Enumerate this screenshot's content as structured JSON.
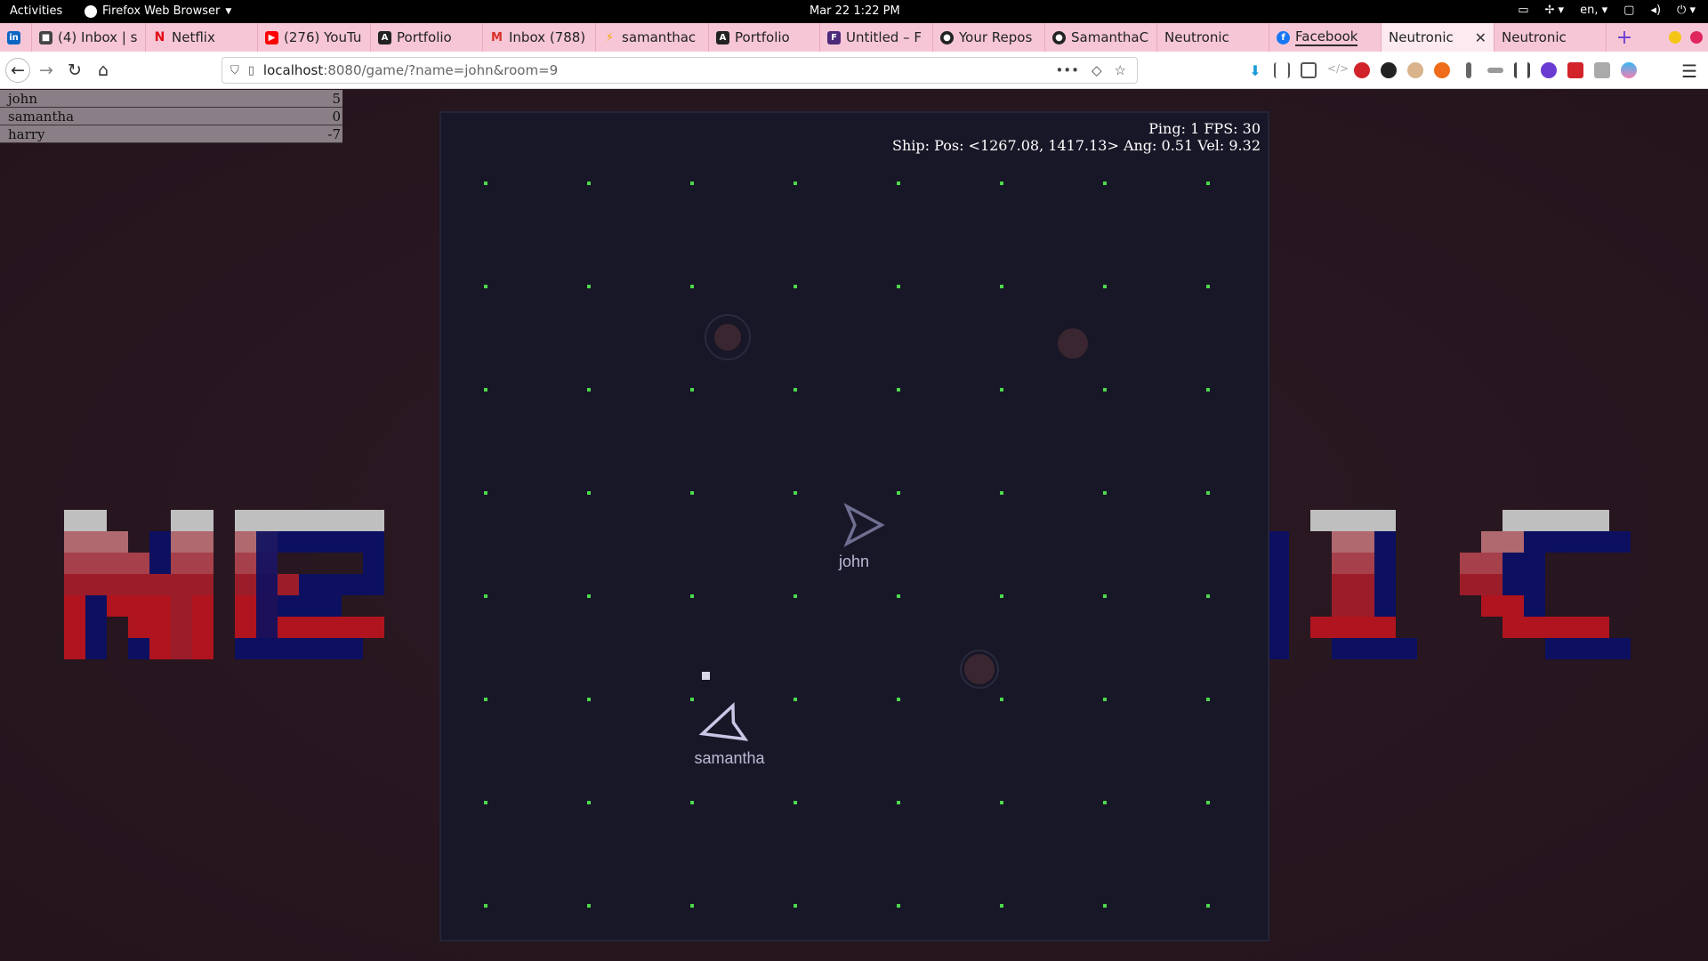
{
  "topbar": {
    "activities": "Activities",
    "app_name": "Firefox Web Browser",
    "clock": "Mar 22  1:22 PM",
    "lang": "en"
  },
  "tabs": [
    {
      "label": "",
      "icon": "linkedin-icon",
      "color": "#0a66c2"
    },
    {
      "label": "(4) Inbox | s",
      "icon": "lock-icon",
      "color": "#444"
    },
    {
      "label": "Netflix",
      "icon": "netflix-icon",
      "color": "#e50914"
    },
    {
      "label": "(276) YouTu",
      "icon": "youtube-icon",
      "color": "#ff0000"
    },
    {
      "label": "Portfolio",
      "icon": "angular-icon",
      "color": "#222"
    },
    {
      "label": "Inbox (788)",
      "icon": "gmail-icon",
      "color": "#d93025"
    },
    {
      "label": "samanthac",
      "icon": "bolt-icon",
      "color": "#f2a900"
    },
    {
      "label": "Portfolio",
      "icon": "angular-icon",
      "color": "#222"
    },
    {
      "label": "Untitled – F",
      "icon": "figma-icon",
      "color": "#4b2a7a"
    },
    {
      "label": "Your Repos",
      "icon": "github-icon",
      "color": "#222"
    },
    {
      "label": "SamanthaC",
      "icon": "github-icon",
      "color": "#222"
    },
    {
      "label": "Neutronic",
      "icon": "",
      "color": ""
    },
    {
      "label": "Facebook",
      "icon": "facebook-icon",
      "color": "#1877f2"
    },
    {
      "label": "Neutronic",
      "icon": "",
      "color": "",
      "active": true
    },
    {
      "label": "Neutronic",
      "icon": "",
      "color": ""
    }
  ],
  "navbar": {
    "url_host": "localhost",
    "url_rest": ":8080/game/?name=john&room=9"
  },
  "scoreboard": [
    {
      "name": "john",
      "score": "5"
    },
    {
      "name": "samantha",
      "score": "0"
    },
    {
      "name": "harry",
      "score": "-7"
    }
  ],
  "game": {
    "ping_fps": "Ping: 1 FPS: 30",
    "ship_info": "Ship: Pos: <1267.08, 1417.13> Ang: 0.51 Vel: 9.32",
    "grid_color": "#4cd94c",
    "players": [
      {
        "name": "john"
      },
      {
        "name": "samantha"
      }
    ]
  },
  "logo": {
    "text": "NEUTRONIC"
  },
  "colors": {
    "page_bg": "#26161e",
    "canvas_bg": "#181727",
    "logo_red": "#b0141e",
    "logo_navy": "#0d1060"
  }
}
